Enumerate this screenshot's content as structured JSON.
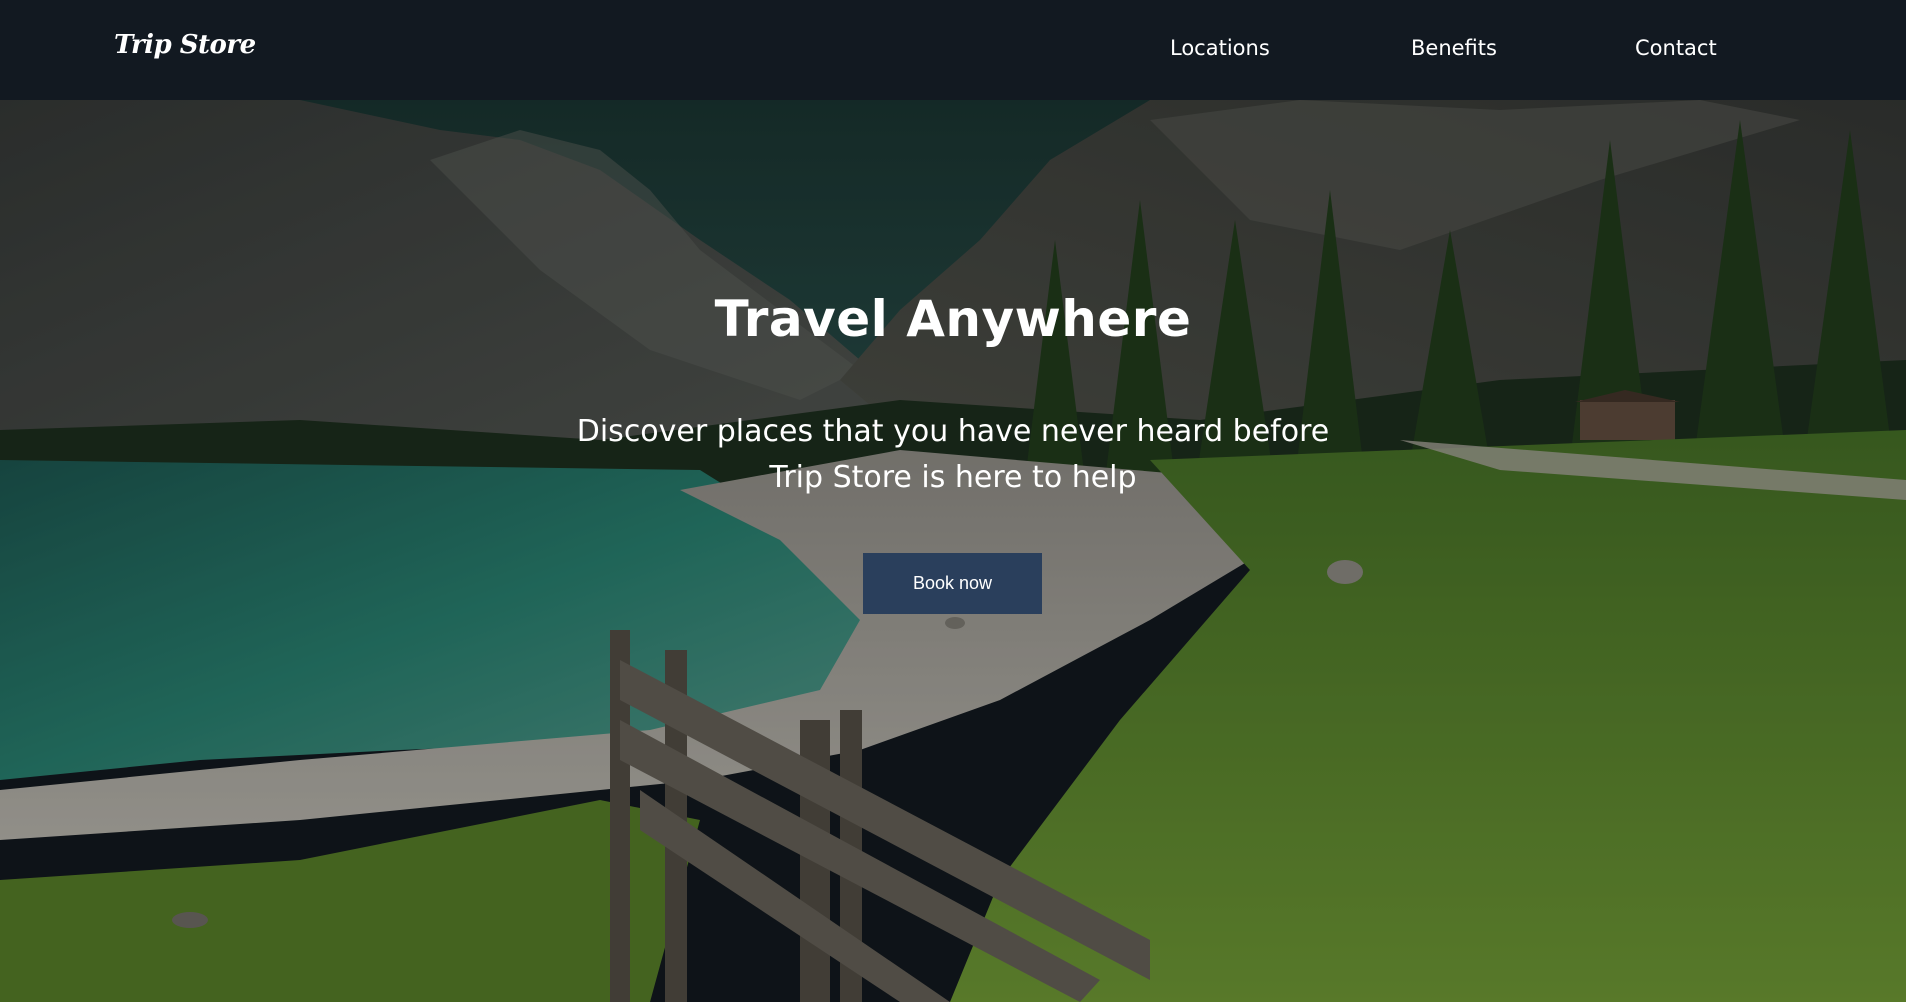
{
  "navbar": {
    "logo": "Trip Store",
    "links": [
      {
        "label": "Locations"
      },
      {
        "label": "Benefits"
      },
      {
        "label": "Contact"
      }
    ]
  },
  "hero": {
    "title": "Travel Anywhere",
    "subtitle_line1": "Discover places that you have never heard before",
    "subtitle_line2": "Trip Store is here to help",
    "cta_label": "Book now"
  },
  "colors": {
    "navbar_bg": "#121921",
    "button_bg": "#2a3f5c",
    "text": "#ffffff"
  }
}
